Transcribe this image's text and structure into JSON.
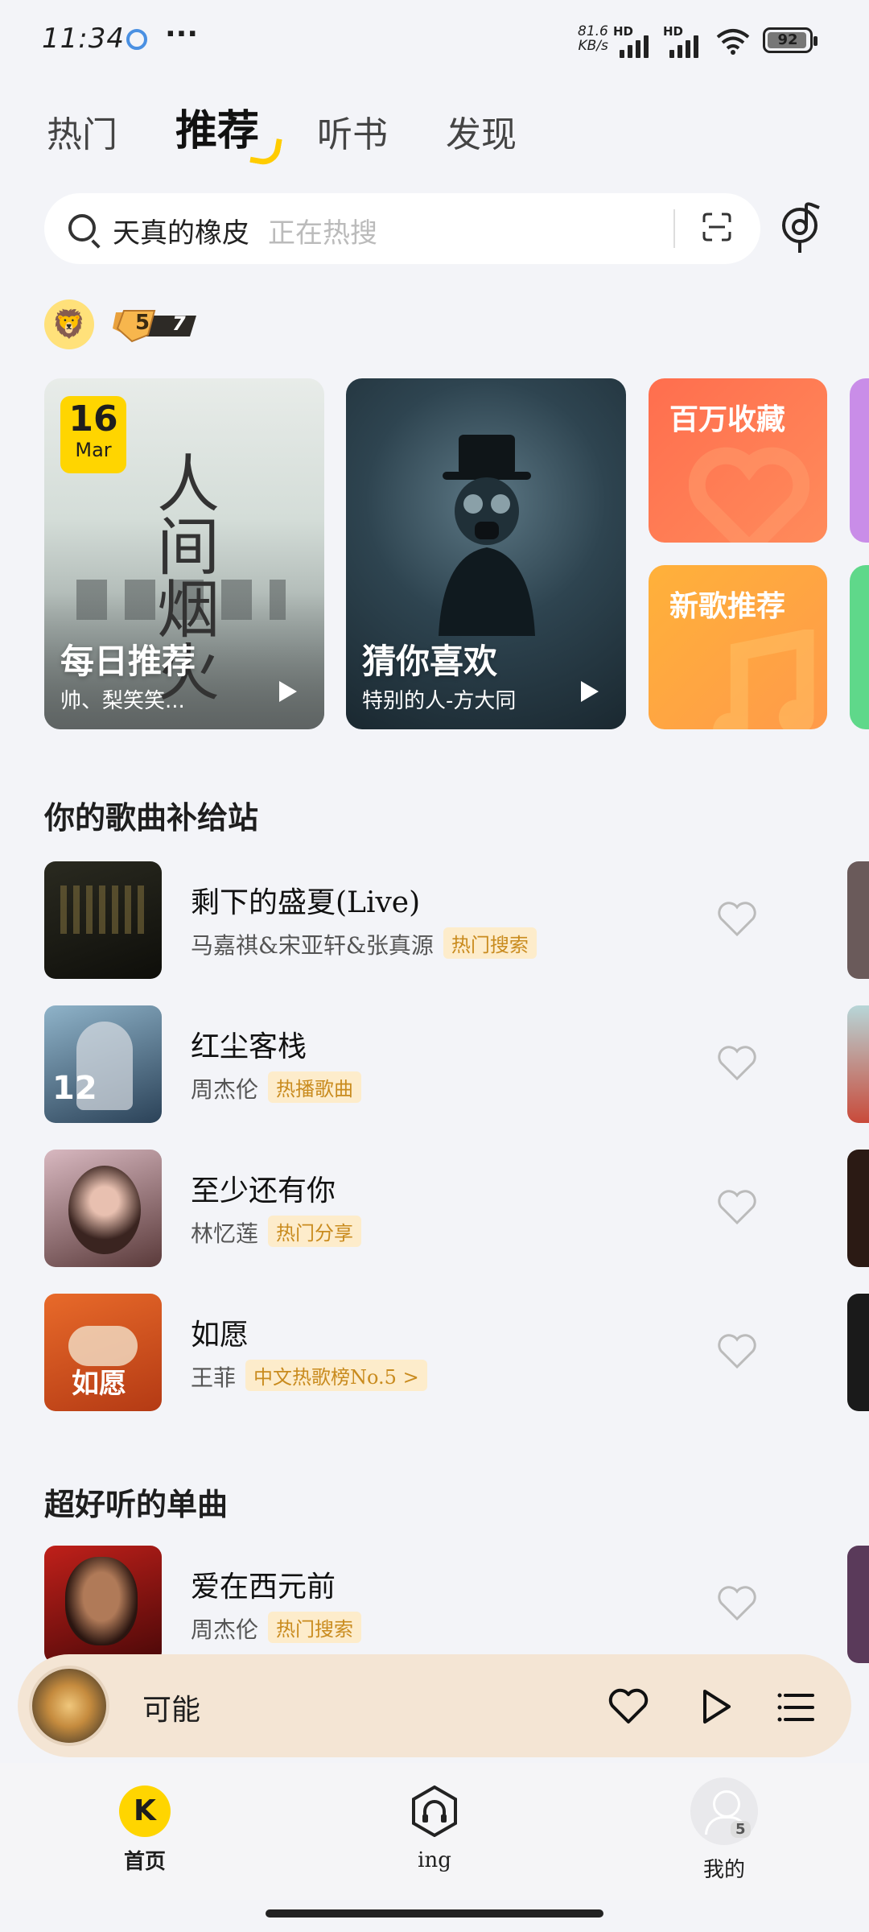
{
  "status": {
    "time": "11:34",
    "net_speed": "81.6",
    "net_unit": "KB/s",
    "hd1": "HD",
    "hd2": "HD",
    "battery": "92"
  },
  "tabs": [
    {
      "label": "热门"
    },
    {
      "label": "推荐"
    },
    {
      "label": "听书"
    },
    {
      "label": "发现"
    }
  ],
  "search": {
    "query": "天真的橡皮",
    "hint": "正在热搜"
  },
  "level_badge": {
    "level": "5",
    "stars": "7"
  },
  "cards": {
    "daily": {
      "day": "16",
      "month": "Mar",
      "title": "每日推荐",
      "subtitle": "帅、梨笑笑...",
      "art_text": "人间烟火"
    },
    "guess": {
      "title": "猜你喜欢",
      "subtitle": "特别的人-方大同"
    },
    "million": {
      "title": "百万收藏"
    },
    "newsong": {
      "title": "新歌推荐"
    }
  },
  "section1": {
    "title": "你的歌曲补给站",
    "songs": [
      {
        "title": "剩下的盛夏(Live)",
        "artist": "马嘉祺&宋亚轩&张真源",
        "tag": "热门搜索"
      },
      {
        "title": "红尘客栈",
        "artist": "周杰伦",
        "tag": "热播歌曲"
      },
      {
        "title": "至少还有你",
        "artist": "林忆莲",
        "tag": "热门分享"
      },
      {
        "title": "如愿",
        "artist": "王菲",
        "tag": "中文热歌榜No.5 >"
      }
    ]
  },
  "section2": {
    "title": "超好听的单曲",
    "songs": [
      {
        "title": "爱在西元前",
        "artist": "周杰伦",
        "tag": "热门搜索"
      }
    ]
  },
  "player": {
    "title": "可能"
  },
  "nav": [
    {
      "label": "首页",
      "icon": "K"
    },
    {
      "label": "ing"
    },
    {
      "label": "我的",
      "badge": "5"
    }
  ]
}
